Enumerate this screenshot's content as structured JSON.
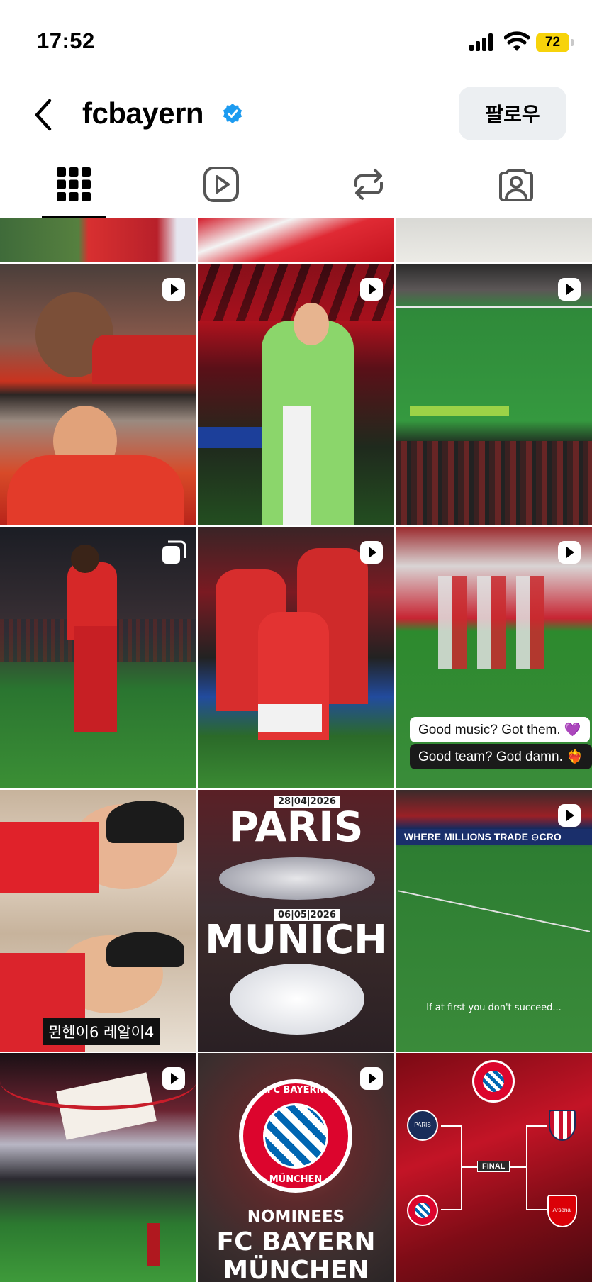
{
  "status_bar": {
    "time": "17:52",
    "battery_level": "72",
    "battery_color": "#f7d30a"
  },
  "header": {
    "back_icon": "chevron-left-icon",
    "username": "fcbayern",
    "verified_icon": "verified-badge-icon",
    "verified_color": "#1d9bf0",
    "follow_label": "팔로우"
  },
  "tabs": [
    {
      "name": "posts",
      "icon": "grid-icon",
      "active": true
    },
    {
      "name": "reels",
      "icon": "reels-icon",
      "active": false
    },
    {
      "name": "reposts",
      "icon": "repost-icon",
      "active": false
    },
    {
      "name": "tagged",
      "icon": "tagged-person-icon",
      "active": false
    }
  ],
  "grid": {
    "posts": [
      {
        "type": "reel",
        "icon": "reel-play-icon"
      },
      {
        "type": "reel",
        "icon": "reel-play-icon"
      },
      {
        "type": "reel",
        "icon": "reel-play-icon"
      },
      {
        "type": "carousel",
        "icon": "carousel-icon"
      },
      {
        "type": "reel",
        "icon": "reel-play-icon",
        "emoji": "🇨🇴🥹"
      },
      {
        "type": "reel",
        "icon": "reel-play-icon",
        "caption_1": "Good music? Got them. 💜",
        "caption_2": "Good team? God damn. ❤️‍🔥"
      },
      {
        "type": "image",
        "caption": "뮌헨이6 레알이4"
      },
      {
        "type": "image",
        "date_1": "28|04|2026",
        "city_1": "PARIS",
        "date_2": "06|05|2026",
        "city_2": "MUNICH"
      },
      {
        "type": "reel",
        "icon": "reel-play-icon",
        "caption": "If at first you don't succeed...",
        "board_text": "WHERE MILLIONS TRADE ⊖CRO"
      },
      {
        "type": "reel",
        "icon": "reel-play-icon"
      },
      {
        "type": "reel",
        "icon": "reel-play-icon",
        "crest_line_1": "FC BAYERN",
        "crest_line_2": "MÜNCHEN",
        "headline_1": "NOMINEES",
        "headline_2": "FC BAYERN",
        "headline_3": "MÜNCHEN"
      },
      {
        "type": "image",
        "crest_top": "FC BAYERN MÜNCHEN",
        "team_1": "PARIS",
        "team_2": "Arsenal",
        "label": "FINAL"
      }
    ]
  }
}
